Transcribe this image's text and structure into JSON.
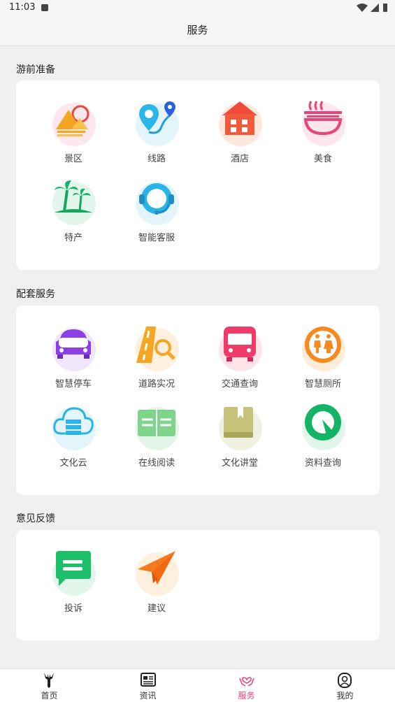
{
  "status_bar": {
    "time": "11:03"
  },
  "header": {
    "title": "服务"
  },
  "sections": [
    {
      "title": "游前准备",
      "items": [
        {
          "label": "景区",
          "icon": "mountain-sun-icon"
        },
        {
          "label": "线路",
          "icon": "route-pin-icon"
        },
        {
          "label": "酒店",
          "icon": "hotel-house-icon"
        },
        {
          "label": "美食",
          "icon": "food-bowl-icon"
        },
        {
          "label": "特产",
          "icon": "palm-island-icon"
        },
        {
          "label": "智能客服",
          "icon": "headset-agent-icon"
        }
      ]
    },
    {
      "title": "配套服务",
      "items": [
        {
          "label": "智慧停车",
          "icon": "car-icon"
        },
        {
          "label": "道路实况",
          "icon": "road-search-icon"
        },
        {
          "label": "交通查询",
          "icon": "bus-icon"
        },
        {
          "label": "智慧厕所",
          "icon": "restroom-icon"
        },
        {
          "label": "文化云",
          "icon": "cloud-server-icon"
        },
        {
          "label": "在线阅读",
          "icon": "open-book-icon"
        },
        {
          "label": "文化讲堂",
          "icon": "closed-book-icon"
        },
        {
          "label": "资料查询",
          "icon": "search-arrow-icon"
        }
      ]
    },
    {
      "title": "意见反馈",
      "items": [
        {
          "label": "投诉",
          "icon": "chat-bubble-icon"
        },
        {
          "label": "建议",
          "icon": "paper-plane-icon"
        }
      ]
    }
  ],
  "tabs": [
    {
      "label": "首页",
      "icon": "deer-icon"
    },
    {
      "label": "资讯",
      "icon": "newspaper-icon"
    },
    {
      "label": "服务",
      "icon": "hands-heart-icon",
      "active": true
    },
    {
      "label": "我的",
      "icon": "user-icon"
    }
  ],
  "colors": {
    "accent": "#e8457a",
    "card": "#ffffff",
    "background": "#f0f0f0"
  }
}
